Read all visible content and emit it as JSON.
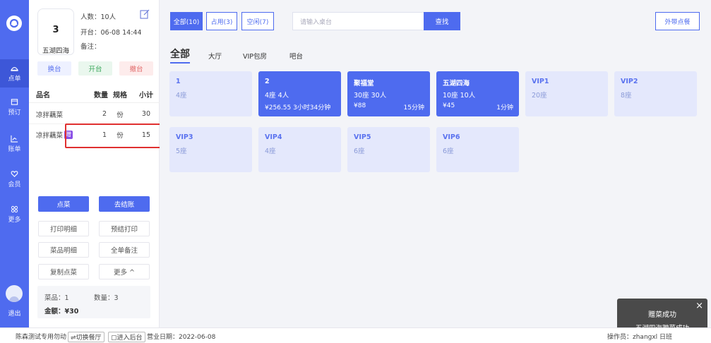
{
  "nav": {
    "items": [
      {
        "label": "点单",
        "icon": "food-cover-icon",
        "active": true
      },
      {
        "label": "预订",
        "icon": "calendar-icon",
        "active": false
      },
      {
        "label": "账单",
        "icon": "chart-icon",
        "active": false
      },
      {
        "label": "会员",
        "icon": "heart-icon",
        "active": false
      },
      {
        "label": "更多",
        "icon": "grid-icon",
        "active": false
      }
    ],
    "logout": "退出"
  },
  "table": {
    "number": "3",
    "name": "五湖四海",
    "people": "人数：10人",
    "opened": "开台：06-08 14:44",
    "note": "备注："
  },
  "actions": {
    "switch": "换台",
    "open": "开台",
    "cancel": "撤台"
  },
  "items_header": {
    "name": "品名",
    "qty": "数量",
    "spec": "规格",
    "subtotal": "小计"
  },
  "items": [
    {
      "name": "凉拌藕菜",
      "gift": "",
      "qty": "2",
      "spec": "份",
      "subtotal": "30"
    },
    {
      "name": "凉拌藕菜",
      "gift": "赠",
      "qty": "1",
      "spec": "份",
      "subtotal": "15"
    }
  ],
  "order_buttons": {
    "order": "点菜",
    "checkout": "去结账",
    "print_detail": "打印明细",
    "pre_print": "预结打印",
    "dish_detail": "菜品明细",
    "whole_note": "全单备注",
    "copy_dish": "复制点菜",
    "more": "更多 ^"
  },
  "summary": {
    "dishes": "菜品：1",
    "count": "数量：3",
    "amount": "金额：¥30"
  },
  "filters": [
    {
      "label": "全部(10)",
      "active": true
    },
    {
      "label": "占用(3)",
      "active": false
    },
    {
      "label": "空闲(7)",
      "active": false
    }
  ],
  "search": {
    "placeholder": "请输入桌台",
    "button": "查找"
  },
  "takeout": "外带点餐",
  "areas": [
    {
      "label": "全部",
      "active": true
    },
    {
      "label": "大厅",
      "active": false
    },
    {
      "label": "VIP包房",
      "active": false
    },
    {
      "label": "吧台",
      "active": false
    }
  ],
  "tables": [
    {
      "name": "1",
      "seats": "4座",
      "amount": "",
      "time": "",
      "busy": false
    },
    {
      "name": "2",
      "seats": "4座  4人",
      "amount": "¥256.55 3小时34分钟",
      "time": "",
      "busy": true
    },
    {
      "name": "聚福堂",
      "seats": "30座  30人",
      "amount": "¥88",
      "time": "15分钟",
      "busy": true
    },
    {
      "name": "五湖四海",
      "seats": "10座  10人",
      "amount": "¥45",
      "time": "1分钟",
      "busy": true
    },
    {
      "name": "VIP1",
      "seats": "20座",
      "amount": "",
      "time": "",
      "busy": false
    },
    {
      "name": "VIP2",
      "seats": "8座",
      "amount": "",
      "time": "",
      "busy": false
    },
    {
      "name": "VIP3",
      "seats": "5座",
      "amount": "",
      "time": "",
      "busy": false
    },
    {
      "name": "VIP4",
      "seats": "4座",
      "amount": "",
      "time": "",
      "busy": false
    },
    {
      "name": "VIP5",
      "seats": "6座",
      "amount": "",
      "time": "",
      "busy": false
    },
    {
      "name": "VIP6",
      "seats": "6座",
      "amount": "",
      "time": "",
      "busy": false
    }
  ],
  "toast": {
    "title": "赠菜成功",
    "message": "五湖四海赠菜成功",
    "close": "×"
  },
  "status": {
    "store": "陈森测试专用勿动",
    "switch_store": "⇌切换餐厅",
    "backend": "▢进入后台",
    "business_date": "营业日期：2022-06-08",
    "operator": "操作员：zhangxl  日班"
  }
}
